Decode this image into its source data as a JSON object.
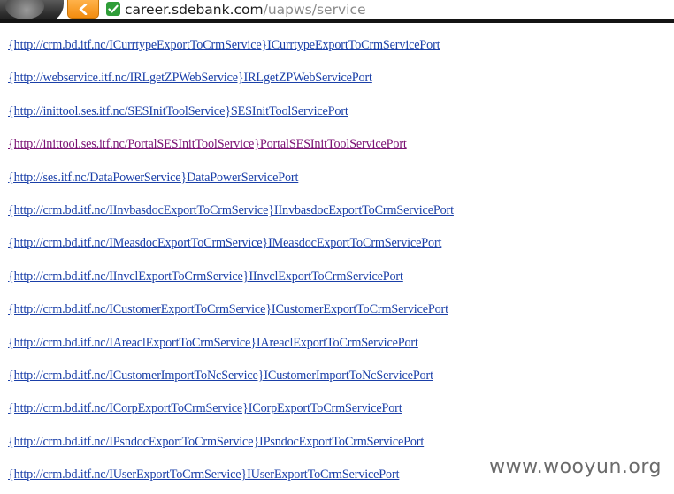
{
  "browser": {
    "address_host": "career.sdebank.com",
    "address_path": "/uapws/service"
  },
  "links": [
    {
      "text": "{http://crm.bd.itf.nc/ICurrtypeExportToCrmService}ICurrtypeExportToCrmServicePort",
      "visited": false
    },
    {
      "text": "{http://webservice.itf.nc/IRLgetZPWebService}IRLgetZPWebServicePort",
      "visited": false
    },
    {
      "text": "{http://inittool.ses.itf.nc/SESInitToolService}SESInitToolServicePort",
      "visited": false
    },
    {
      "text": "{http://inittool.ses.itf.nc/PortalSESInitToolService}PortalSESInitToolServicePort",
      "visited": true
    },
    {
      "text": "{http://ses.itf.nc/DataPowerService}DataPowerServicePort",
      "visited": false
    },
    {
      "text": "{http://crm.bd.itf.nc/IInvbasdocExportToCrmService}IInvbasdocExportToCrmServicePort",
      "visited": false
    },
    {
      "text": "{http://crm.bd.itf.nc/IMeasdocExportToCrmService}IMeasdocExportToCrmServicePort",
      "visited": false
    },
    {
      "text": "{http://crm.bd.itf.nc/IInvclExportToCrmService}IInvclExportToCrmServicePort",
      "visited": false
    },
    {
      "text": "{http://crm.bd.itf.nc/ICustomerExportToCrmService}ICustomerExportToCrmServicePort",
      "visited": false
    },
    {
      "text": "{http://crm.bd.itf.nc/IAreaclExportToCrmService}IAreaclExportToCrmServicePort",
      "visited": false
    },
    {
      "text": "{http://crm.bd.itf.nc/ICustomerImportToNcService}ICustomerImportToNcServicePort",
      "visited": false
    },
    {
      "text": "{http://crm.bd.itf.nc/ICorpExportToCrmService}ICorpExportToCrmServicePort",
      "visited": false
    },
    {
      "text": "{http://crm.bd.itf.nc/IPsndocExportToCrmService}IPsndocExportToCrmServicePort",
      "visited": false
    },
    {
      "text": "{http://crm.bd.itf.nc/IUserExportToCrmService}IUserExportToCrmServicePort",
      "visited": false
    }
  ],
  "watermark": "www.wooyun.org",
  "colors": {
    "link": "#1a3fa8",
    "visited_link": "#7b1273",
    "back_button": "#f28c0f",
    "secure_badge": "#2f9d38"
  }
}
